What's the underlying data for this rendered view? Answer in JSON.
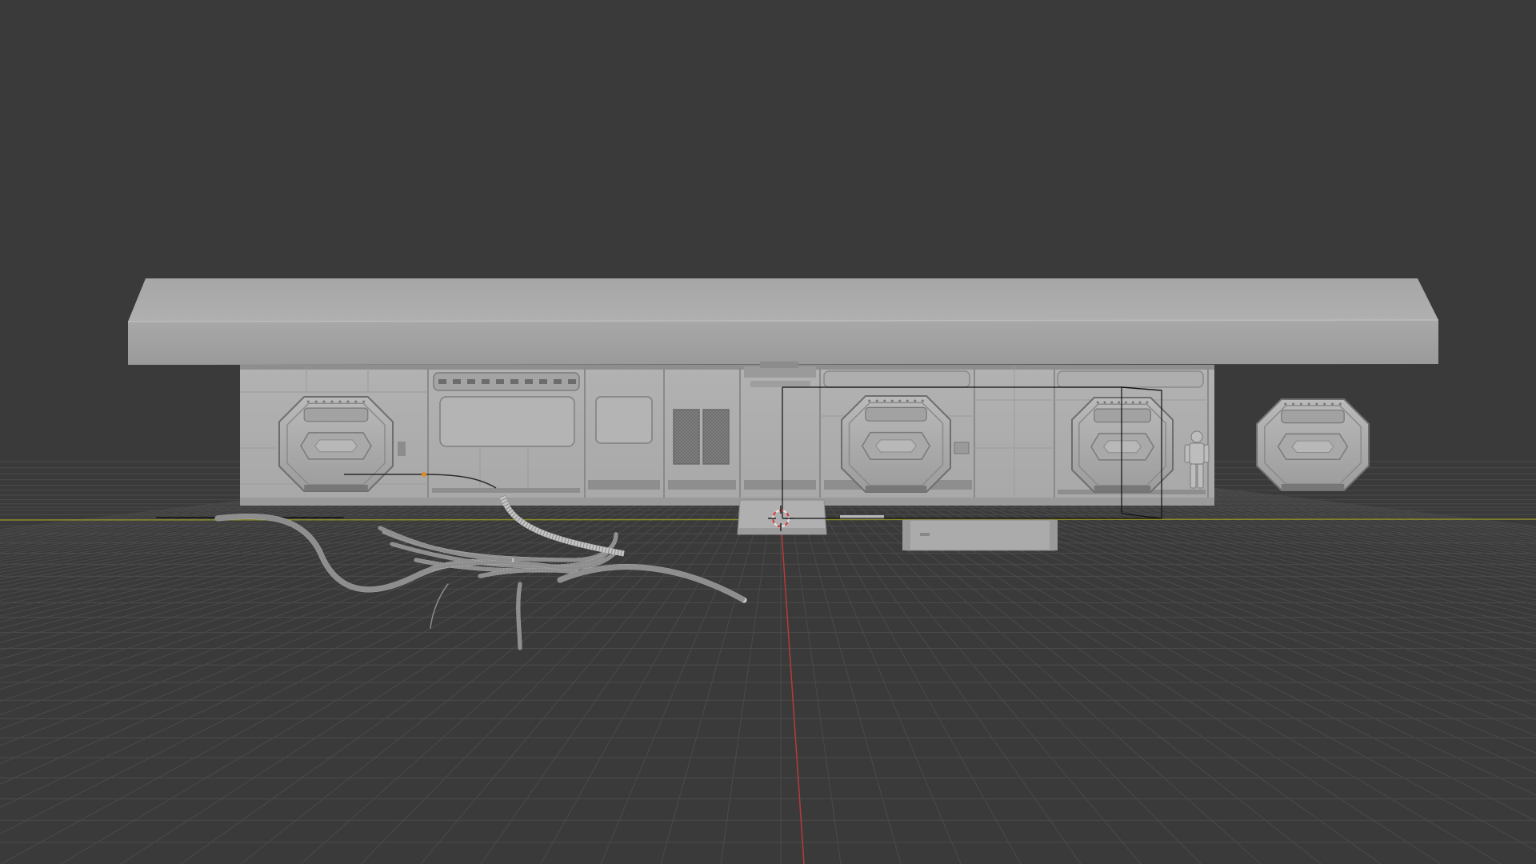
{
  "app": {
    "kind": "3d-viewport",
    "background_color": "#3a3a3a"
  },
  "viewport": {
    "grid": true,
    "grid_color": "#4a4a4a",
    "x_axis_color": "#8a8a2a",
    "y_axis_color": "#b83a3a",
    "model_color": "#b4b4b4",
    "selection_color": "#000000",
    "objects": [
      {
        "name": "corridor-wall-module",
        "selected": false
      },
      {
        "name": "roof-slab",
        "selected": false
      },
      {
        "name": "octagonal-wall-panel-left",
        "selected": false
      },
      {
        "name": "octagonal-wall-panel-center",
        "selected": false
      },
      {
        "name": "octagonal-wall-panel-right",
        "selected": true
      },
      {
        "name": "standalone-octagonal-panel",
        "selected": false
      },
      {
        "name": "vent-grilles",
        "selected": false
      },
      {
        "name": "door-step",
        "selected": false
      },
      {
        "name": "floor-pipe",
        "selected": false
      },
      {
        "name": "cable-bundle",
        "selected": false
      },
      {
        "name": "scale-figure",
        "selected": false
      },
      {
        "name": "3d-cursor",
        "selected": false
      }
    ]
  }
}
